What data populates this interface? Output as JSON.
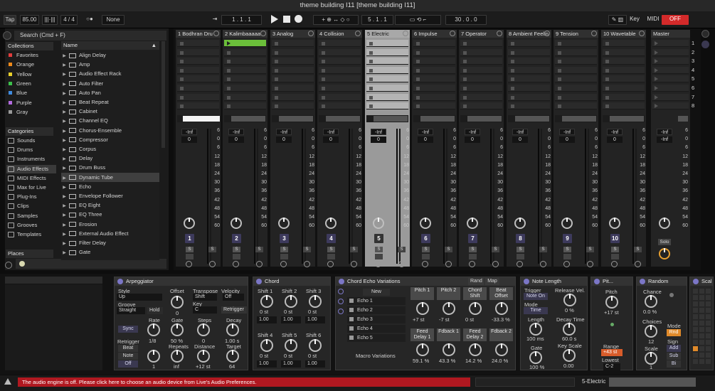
{
  "window": {
    "title": "theme building I11  [theme building I11]"
  },
  "transport": {
    "tap": "Tap",
    "bpm": "85.00",
    "sig": "4 / 4",
    "dot": "○●",
    "quant": "None",
    "arr_pos": "1 .  1 .  1",
    "loop_start": "5 .  1 .  1",
    "loop_len": "30 .  0 .  0",
    "key": "Key",
    "midi": "MIDI",
    "midi_state": "OFF"
  },
  "browser": {
    "search": "Search (Cmd + F)",
    "collections_head": "Collections",
    "collections": [
      {
        "label": "Favorites",
        "color": "#e33d3d"
      },
      {
        "label": "Orange",
        "color": "#ef8a1a"
      },
      {
        "label": "Yellow",
        "color": "#e9d02b"
      },
      {
        "label": "Green",
        "color": "#3cc04b"
      },
      {
        "label": "Blue",
        "color": "#3f8be0"
      },
      {
        "label": "Purple",
        "color": "#b36be0"
      },
      {
        "label": "Gray",
        "color": "#9a9a9a"
      }
    ],
    "categories_head": "Categories",
    "categories": [
      {
        "label": "Sounds",
        "icon": "sounds-icon"
      },
      {
        "label": "Drums",
        "icon": "drums-icon"
      },
      {
        "label": "Instruments",
        "icon": "instruments-icon"
      },
      {
        "label": "Audio Effects",
        "icon": "audio-effects-icon"
      },
      {
        "label": "MIDI Effects",
        "icon": "midi-effects-icon"
      },
      {
        "label": "Max for Live",
        "icon": "max-icon"
      },
      {
        "label": "Plug-Ins",
        "icon": "plugins-icon"
      },
      {
        "label": "Clips",
        "icon": "clips-icon"
      },
      {
        "label": "Samples",
        "icon": "samples-icon"
      },
      {
        "label": "Grooves",
        "icon": "grooves-icon"
      },
      {
        "label": "Templates",
        "icon": "templates-icon"
      }
    ],
    "places_head": "Places",
    "name_head": "Name",
    "items": [
      "Align Delay",
      "Amp",
      "Audio Effect Rack",
      "Auto Filter",
      "Auto Pan",
      "Beat Repeat",
      "Cabinet",
      "Channel EQ",
      "Chorus-Ensemble",
      "Compressor",
      "Corpus",
      "Delay",
      "Drum Buss",
      "Dynamic Tube",
      "Echo",
      "Envelope Follower",
      "EQ Eight",
      "EQ Three",
      "Erosion",
      "External Audio Effect",
      "Filter Delay",
      "Gate"
    ]
  },
  "tracks": [
    {
      "name": "1 Bodhran Dru",
      "num": "1"
    },
    {
      "name": "2 Kalimbaaaaa",
      "num": "2"
    },
    {
      "name": "3 Analog",
      "num": "3"
    },
    {
      "name": "4 Collision",
      "num": "4"
    },
    {
      "name": "5 Electric",
      "num": "5"
    },
    {
      "name": "6 Impulse",
      "num": "6"
    },
    {
      "name": "7 Operator",
      "num": "7"
    },
    {
      "name": "8 Ambient Feelin",
      "num": "8"
    },
    {
      "name": "9 Tension",
      "num": "9"
    },
    {
      "name": "10 Wavetable",
      "num": "10"
    }
  ],
  "master": {
    "name": "Master",
    "solo": "Solo"
  },
  "scene_nums": [
    "1",
    "2",
    "3",
    "4",
    "5",
    "6",
    "7",
    "8"
  ],
  "mixer": {
    "vol": "-Inf",
    "pan": "0",
    "s": "S",
    "scale": [
      "6",
      "0",
      "6",
      "12",
      "18",
      "24",
      "30",
      "36",
      "42",
      "48",
      "54",
      "60"
    ],
    "scale_master": [
      "6",
      "0",
      "6",
      "12",
      "18",
      "24",
      "30",
      "36",
      "42",
      "48",
      "54",
      "60"
    ]
  },
  "devices": {
    "arp": {
      "title": "Arpeggiator",
      "style_lbl": "Style",
      "style": "Up",
      "groove_lbl": "Groove",
      "groove": "Straight",
      "hold": "Hold",
      "offset_lbl": "Offset",
      "offset": "0",
      "transpose_lbl": "Transpose",
      "transpose": "Shift",
      "key_lbl": "Key",
      "key": "C",
      "velocity_lbl": "Velocity",
      "velocity": "Off",
      "retrigger_btn": "Retrigger",
      "sync": "Sync",
      "rate_lbl": "Rate",
      "rate": "1/8",
      "gate_lbl": "Gate",
      "gate": "50 %",
      "steps_lbl": "Steps",
      "steps": "0",
      "decay_lbl": "Decay",
      "decay": "1.00 s",
      "retrig_lbl": "Retrigger",
      "beat": "Beat",
      "note": "Note",
      "off": "Off",
      "repeats_lbl": "Repeats",
      "repeats": "inf",
      "distance_lbl": "Distance",
      "distance": "+12 st",
      "target_lbl": "Target",
      "target": "64",
      "one": "1"
    },
    "chord": {
      "title": "Chord",
      "shifts": [
        "Shift 1",
        "Shift 2",
        "Shift 3",
        "Shift 4",
        "Shift 5",
        "Shift 6"
      ],
      "shift_val": "0 st",
      "mult": "1.00"
    },
    "echo": {
      "title": "Chord Echo Variations",
      "rand": "Rand",
      "map": "Map",
      "new": "New",
      "variations": [
        "Echo 1",
        "Echo 2",
        "Echo 3",
        "Echo 4",
        "Echo 5"
      ],
      "macro": "Macro Variations",
      "macros": [
        {
          "l": "Pitch 1",
          "v": "+7 st"
        },
        {
          "l": "Pitch 2",
          "v": "-7 st"
        },
        {
          "l": "Chord Shift",
          "v": "0 st"
        },
        {
          "l": "Beat Offset",
          "v": "-33.3 %"
        },
        {
          "l": "Feed Delay 1",
          "v": "59.1 %"
        },
        {
          "l": "Fdback 1",
          "v": "43.3 %"
        },
        {
          "l": "Feed Delay 2",
          "v": "14.2 %"
        },
        {
          "l": "Fdback 2",
          "v": "24.0 %"
        }
      ]
    },
    "notelen": {
      "title": "Note Length",
      "trigger_lbl": "Trigger",
      "trigger": "Note On",
      "mode_lbl": "Mode",
      "mode": "Time",
      "release_lbl": "Release Vel.",
      "release": "0 %",
      "length_lbl": "Length",
      "length": "100 ms",
      "decay_lbl": "Decay Time",
      "decay": "60.0 s",
      "gate_lbl": "Gate",
      "gate": "100 %",
      "keyscale_lbl": "Key Scale",
      "keyscale": "0.00"
    },
    "pitch": {
      "title": "Pit...",
      "pitch_lbl": "Pitch",
      "pitch": "+17 st",
      "range_lbl": "Range",
      "range": "+43 st",
      "lowest_lbl": "Lowest",
      "lowest": "C-2"
    },
    "random": {
      "title": "Random",
      "chance_lbl": "Chance",
      "chance": "0.0 %",
      "choices_lbl": "Choices",
      "choices": "12",
      "scale_lbl": "Scale",
      "scale": "1",
      "mode_lbl": "Mode",
      "mode": "Rnd",
      "sign_lbl": "Sign",
      "add": "Add",
      "sub": "Sub",
      "bi": "Bi"
    },
    "scale": {
      "title": "Scal"
    }
  },
  "status": {
    "message": "The audio engine is off. Please click here to choose an audio device from Live's Audio Preferences.",
    "track": "5-Electric"
  },
  "colors": {
    "accent": "#7b76c6",
    "selected_clip": "#6bbf3a",
    "error": "#b01820",
    "midi_off": "#d32a2a"
  }
}
